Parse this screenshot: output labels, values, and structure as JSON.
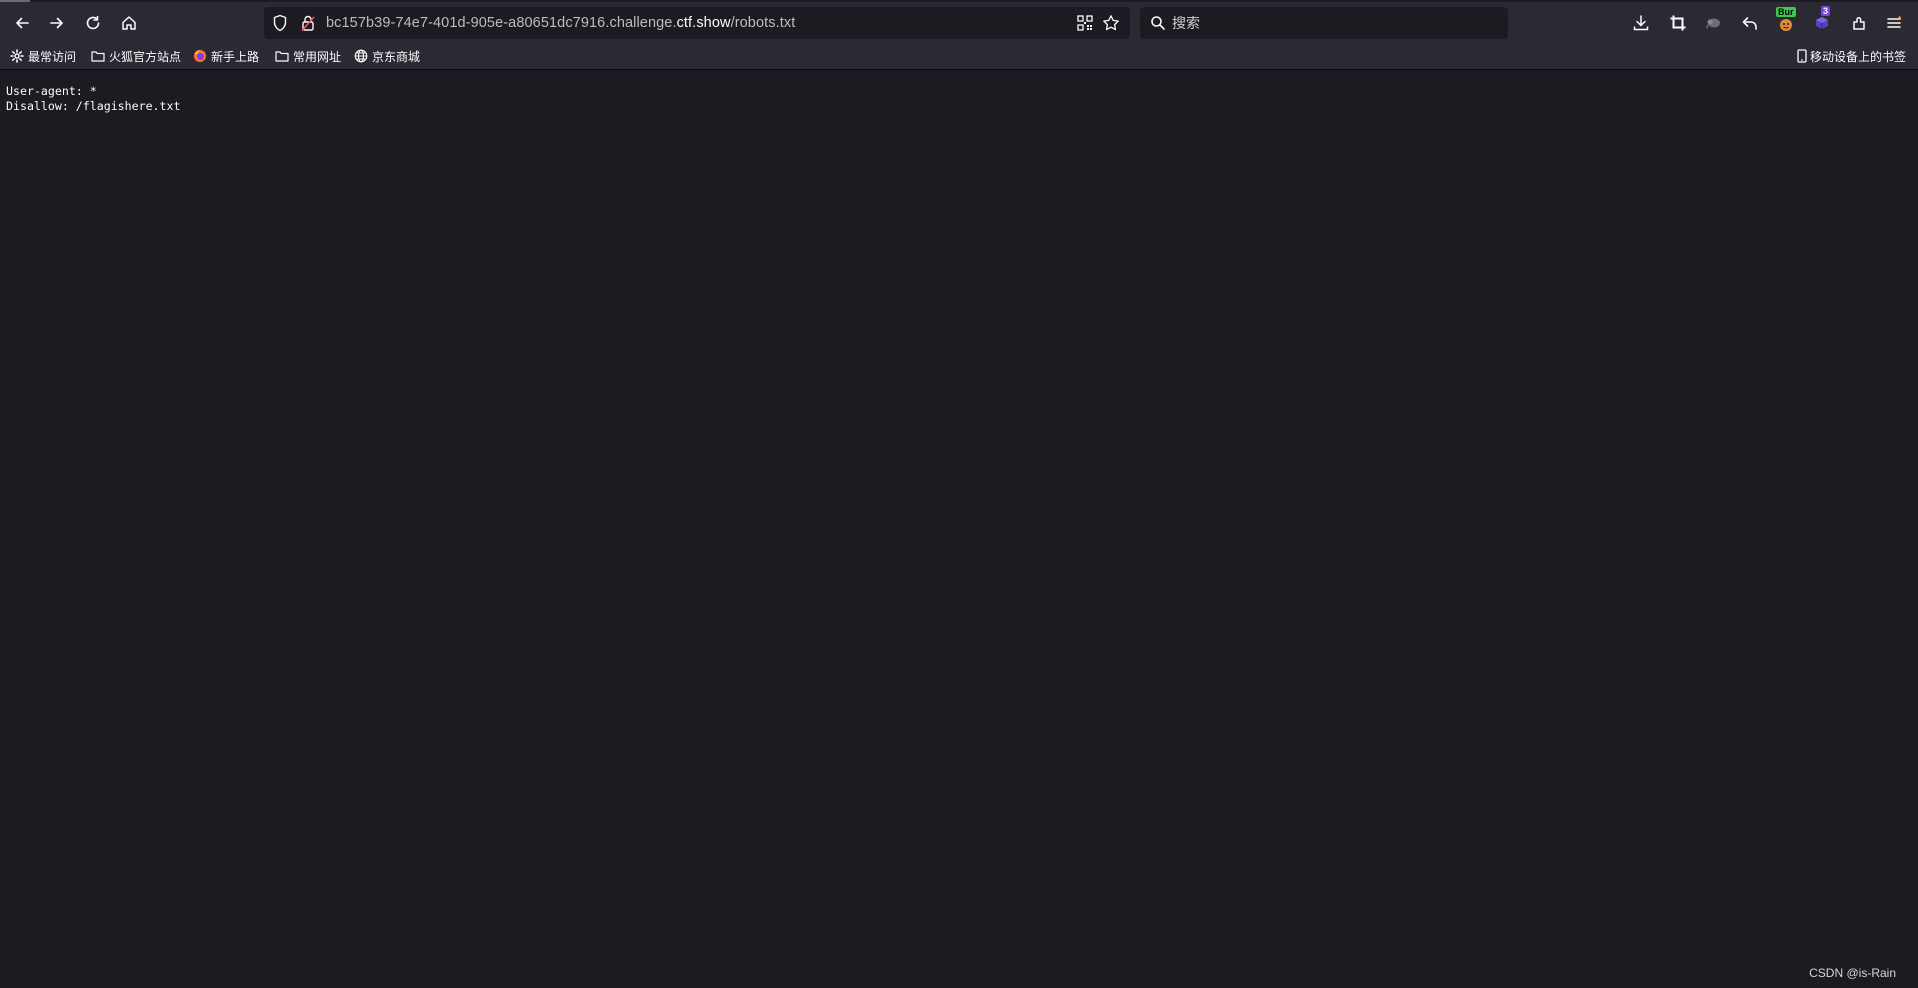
{
  "browser": {
    "url": {
      "prefix": "bc157b39-74e7-401d-905e-a80651dc7916.challenge.",
      "host": "ctf.show",
      "path": "/robots.txt"
    },
    "search": {
      "placeholder": "搜索"
    },
    "extensions": {
      "burp_badge": "Bur",
      "count_badge": "3"
    },
    "icons": [
      "back-icon",
      "forward-icon",
      "reload-icon",
      "home-icon",
      "shield-icon",
      "lock-icon",
      "qr-code-icon",
      "star-icon",
      "search-icon",
      "download-icon",
      "crop-icon",
      "elephant-icon",
      "undo-icon",
      "burp-extension-icon",
      "cube-extension-icon",
      "extensions-icon",
      "menu-icon"
    ]
  },
  "bookmarks": {
    "items": [
      {
        "label": "最常访问",
        "icon": "gear-icon"
      },
      {
        "label": "火狐官方站点",
        "icon": "folder-icon"
      },
      {
        "label": "新手上路",
        "icon": "firefox-icon"
      },
      {
        "label": "常用网址",
        "icon": "folder-icon"
      },
      {
        "label": "京东商城",
        "icon": "globe-icon"
      }
    ],
    "mobile": {
      "label": "移动设备上的书签",
      "icon": "mobile-icon"
    }
  },
  "page": {
    "lines": [
      "User-agent: *",
      "Disallow: /flagishere.txt"
    ]
  },
  "watermark": "CSDN @is-Rain",
  "colors": {
    "toolbar": "#2b2a33",
    "background": "#1c1b22",
    "text": "#fbfbfe",
    "burp_badge": "#3ec94d",
    "count_badge": "#7542e5"
  }
}
